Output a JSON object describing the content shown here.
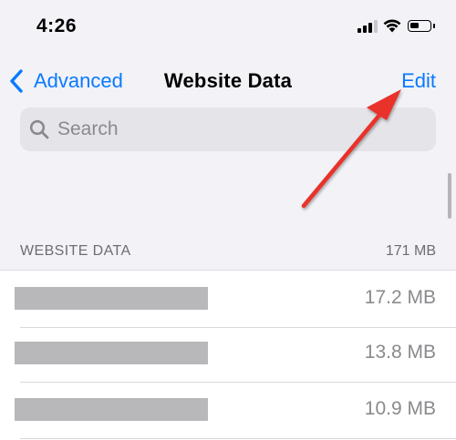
{
  "status_bar": {
    "time": "4:26"
  },
  "nav": {
    "back_label": "Advanced",
    "title": "Website Data",
    "edit_label": "Edit"
  },
  "search": {
    "placeholder": "Search"
  },
  "section": {
    "header": "WEBSITE DATA",
    "total": "171 MB"
  },
  "rows": [
    {
      "size": "17.2 MB"
    },
    {
      "size": "13.8 MB"
    },
    {
      "size": "10.9 MB"
    }
  ],
  "icons": {
    "back": "chevron-left-icon",
    "search": "search-icon",
    "annotation": "red-arrow-icon"
  },
  "colors": {
    "accent": "#0a7aff",
    "annotation_arrow": "#e8322b",
    "background": "#f2f2f7"
  }
}
